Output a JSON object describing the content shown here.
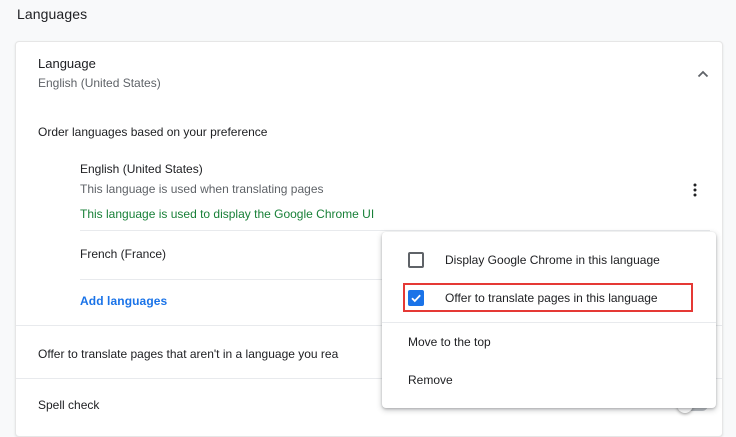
{
  "section": {
    "title": "Languages"
  },
  "language": {
    "title": "Language",
    "current": "English (United States)",
    "collapse_icon": "chevron-up-icon"
  },
  "order": {
    "label": "Order languages based on your preference"
  },
  "languages": [
    {
      "name": "English (United States)",
      "note_translate": "This language is used when translating pages",
      "note_ui": "This language is used to display the Google Chrome UI",
      "menu_icon": "more-vert-icon"
    },
    {
      "name": "French (France)"
    }
  ],
  "add_languages": {
    "label": "Add languages"
  },
  "offer_translate": {
    "label": "Offer to translate pages that aren't in a language you rea"
  },
  "spell_check": {
    "label": "Spell check",
    "enabled": false
  },
  "context_menu": {
    "items": [
      {
        "label": "Display Google Chrome in this language",
        "type": "checkbox",
        "checked": false
      },
      {
        "label": "Offer to translate pages in this language",
        "type": "checkbox",
        "checked": true
      },
      {
        "label": "Move to the top",
        "type": "action"
      },
      {
        "label": "Remove",
        "type": "action"
      }
    ]
  },
  "colors": {
    "accent": "#1a73e8",
    "ui_note": "#188038",
    "highlight": "#e53935",
    "secondary_text": "#5f6368"
  }
}
